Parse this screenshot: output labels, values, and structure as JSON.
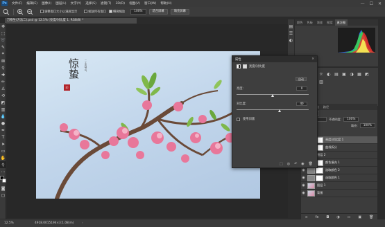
{
  "menubar": {
    "logo": "Ps",
    "items": [
      "文件(F)",
      "编辑(E)",
      "图像(I)",
      "图层(L)",
      "文字(Y)",
      "选择(S)",
      "滤镜(T)",
      "3D(D)",
      "视图(V)",
      "窗口(W)",
      "帮助(H)"
    ],
    "win_buttons": [
      "—",
      "☐",
      "✕"
    ]
  },
  "options": {
    "check1_label": "调整窗口大小以满屏显示",
    "check2_label": "缩放所有窗口",
    "check3_label": "细微缩放",
    "zoom_value": "100%",
    "fit_screen": "适合屏幕",
    "fill_screen": "填充屏幕"
  },
  "document": {
    "tab_title": "万物生(方法二).psd @ 12.5% (亮度/对比度 1, RGB/8) *",
    "calligraphy": "惊蛰",
    "small_text": "二十四节气",
    "seal_text": "印"
  },
  "statusbar": {
    "zoom": "12.5%",
    "doc_info": "4918.0015194×3:1.08(m)"
  },
  "panels": {
    "hist_tabs": [
      "颜色",
      "色板",
      "渐变",
      "图案",
      "直方图"
    ],
    "pipe_icons": [
      "☼",
      "◐",
      "▤",
      "▣",
      "◑",
      "▦",
      "◩",
      "▥"
    ],
    "layers_tabs": [
      "图层",
      "通道",
      "路径"
    ],
    "layers_kind": "p 类型",
    "blend_mode": "正常",
    "opacity_label": "不透明度:",
    "opacity_value": "100%",
    "fill_label": "填充:",
    "fill_value": "100%",
    "lock_label": "锁定:"
  },
  "layers": [
    {
      "name": "亮度/对比度 1",
      "selected": true,
      "mask": true
    },
    {
      "name": "曲线拆分",
      "selected": false,
      "mask": true
    },
    {
      "name": "图层 2",
      "selected": false,
      "mask": false
    },
    {
      "name": "颜色填充 1",
      "selected": false,
      "mask": true
    },
    {
      "name": "选取颜色 2",
      "selected": false,
      "mask": true
    },
    {
      "name": "选取颜色 1",
      "selected": false,
      "mask": true
    },
    {
      "name": "图层 1",
      "selected": false,
      "mask": false
    },
    {
      "name": "背景",
      "selected": false,
      "mask": false
    }
  ],
  "layers_footer": [
    "∞",
    "fx",
    "◘",
    "◑",
    "▭",
    "▣",
    "🗑"
  ],
  "properties": {
    "title": "属性",
    "close": "✕",
    "adjustment_name": "亮度/对比度",
    "auto_label": "自动",
    "brightness_label": "亮度:",
    "brightness_value": "0",
    "contrast_label": "对比度:",
    "contrast_value": "40",
    "legacy_label": "使用旧版",
    "brightness_level": 0.5,
    "contrast_level": 0.6,
    "footer_icons": [
      "⬚",
      "◎",
      "↶",
      "◉",
      "🗑"
    ]
  },
  "colors": {
    "accent": "#4a7fb8",
    "seal_red": "#b2242a",
    "blossom": "#e8779a"
  }
}
